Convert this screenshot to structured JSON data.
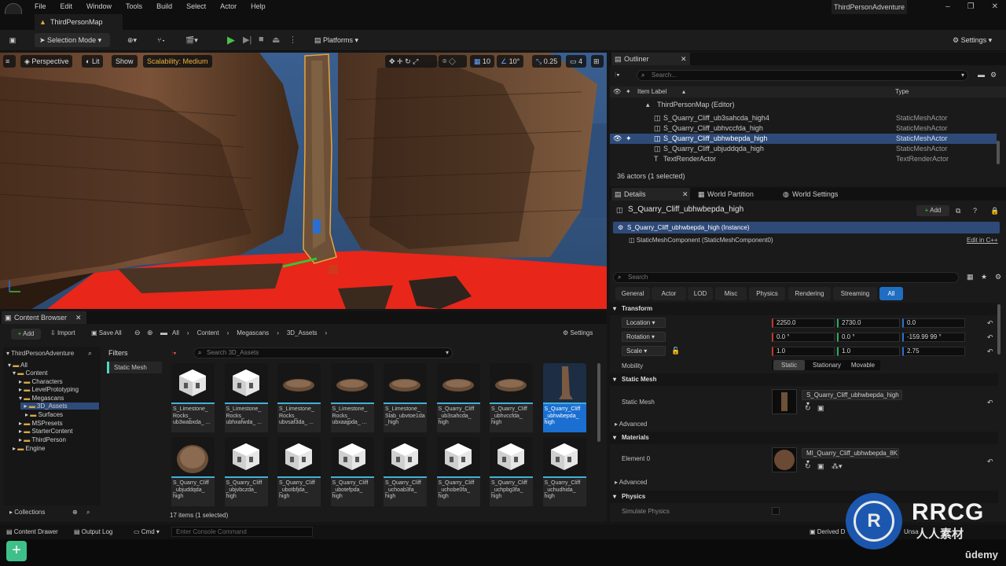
{
  "menu": {
    "items": [
      "File",
      "Edit",
      "Window",
      "Tools",
      "Build",
      "Select",
      "Actor",
      "Help"
    ]
  },
  "window": {
    "project_title": "ThirdPersonAdventure",
    "map_tab": "ThirdPersonMap"
  },
  "toolbar": {
    "selection_mode": "Selection Mode",
    "platforms": "Platforms",
    "settings": "Settings"
  },
  "viewport": {
    "perspective": "Perspective",
    "lit": "Lit",
    "show": "Show",
    "scalability": "Scalability: Medium",
    "grid_snap": "10",
    "rot_snap": "10°",
    "scale_snap": "0.25",
    "camera_speed": "4"
  },
  "outliner": {
    "tab": "Outliner",
    "search_placeholder": "Search...",
    "col_label": "Item Label",
    "col_type": "Type",
    "map_row": "ThirdPersonMap (Editor)",
    "rows": [
      {
        "label": "S_Quarry_Cliff_ub3sahcda_high4",
        "type": "StaticMeshActor"
      },
      {
        "label": "S_Quarry_Cliff_ubhvccfda_high",
        "type": "StaticMeshActor"
      },
      {
        "label": "S_Quarry_Cliff_ubhwbepda_high",
        "type": "StaticMeshActor"
      },
      {
        "label": "S_Quarry_Cliff_ubjuddqda_high",
        "type": "StaticMeshActor"
      },
      {
        "label": "TextRenderActor",
        "type": "TextRenderActor"
      }
    ],
    "count": "36 actors (1 selected)"
  },
  "details": {
    "tabs": [
      "Details",
      "World Partition",
      "World Settings"
    ],
    "actor_name": "S_Quarry_Cliff_ubhwbepda_high",
    "add": "Add",
    "instance_row": "S_Quarry_Cliff_ubhwbepda_high (Instance)",
    "component_row": "StaticMeshComponent (StaticMeshComponent0)",
    "edit_cpp": "Edit in C++",
    "search_placeholder": "Search",
    "categories": [
      "General",
      "Actor",
      "LOD",
      "Misc",
      "Physics",
      "Rendering",
      "Streaming",
      "All"
    ],
    "transform_header": "Transform",
    "location_label": "Location",
    "location": [
      "2250.0",
      "2730.0",
      "0.0"
    ],
    "rotation_label": "Rotation",
    "rotation": [
      "0.0 °",
      "0.0 °",
      "-159.99 99 °"
    ],
    "scale_label": "Scale",
    "scale": [
      "1.0",
      "1.0",
      "2.75"
    ],
    "mobility_label": "Mobility",
    "mobility": [
      "Static",
      "Stationary",
      "Movable"
    ],
    "static_mesh_header": "Static Mesh",
    "static_mesh_label": "Static Mesh",
    "static_mesh_value": "S_Quarry_Cliff_ubhwbepda_high",
    "advanced": "Advanced",
    "materials_header": "Materials",
    "element0_label": "Element 0",
    "element0_value": "MI_Quarry_Cliff_ubhwbepda_8K",
    "advanced2": "Advanced",
    "physics_header": "Physics",
    "simulate_physics": "Simulate Physics"
  },
  "content_browser": {
    "tab": "Content Browser",
    "add": "Add",
    "import": "Import",
    "save_all": "Save All",
    "breadcrumb": [
      "All",
      "Content",
      "Megascans",
      "3D_Assets"
    ],
    "settings": "Settings",
    "project": "ThirdPersonAdventure",
    "filters": "Filters",
    "filter_chip": "Static Mesh",
    "search_placeholder": "Search 3D_Assets",
    "tree": [
      "All",
      "Content",
      "Characters",
      "LevelPrototyping",
      "Megascans",
      "3D_Assets",
      "Surfaces",
      "MSPresets",
      "StarterContent",
      "ThirdPerson",
      "Engine"
    ],
    "assets_row1": [
      "S_Limestone_ Rocks_ ub3wabxda_ ...",
      "S_Limestone_ Rocks_ ubhxafwda_ ...",
      "S_Limestone_ Rocks_ ubvsaf3da_ ...",
      "S_Limestone_ Rocks_ ubxaajpda_ ...",
      "S_Limestone_ Slab_ubvtoe1da _high",
      "S_Quarry_Cliff _ub3sahcda_ high",
      "S_Quarry_Cliff _ubhvccfda_ high",
      "S_Quarry_Cliff _ubhwbepda_ high"
    ],
    "assets_row2": [
      "S_Quarry_Cliff _ubjuddqda_ high",
      "S_Quarry_Cliff _ubjvbczda_ high",
      "S_Quarry_Cliff _ubotbfjda_ high",
      "S_Quarry_Cliff _ubotefpda_ high",
      "S_Quarry_Cliff _uchoab3fa_ high",
      "S_Quarry_Cliff _uchobe0fa_ high",
      "S_Quarry_Cliff _uchpbg3fa_ high",
      "S_Quarry_Cliff _uchudhida_ high"
    ],
    "count": "17 items (1 selected)",
    "collections": "Collections"
  },
  "statusbar": {
    "content_drawer": "Content Drawer",
    "output_log": "Output Log",
    "cmd": "Cmd",
    "console_placeholder": "Enter Console Command",
    "derived": "Derived D",
    "unsaved": "Unsa"
  },
  "watermark": {
    "brand": "RRCG",
    "sub": "人人素材",
    "udemy": "ūdemy"
  },
  "colors": {
    "accent": "#1f6ec2",
    "selection": "#2e4a78",
    "cyan": "#42b0d8",
    "floor": "#e8261a"
  }
}
